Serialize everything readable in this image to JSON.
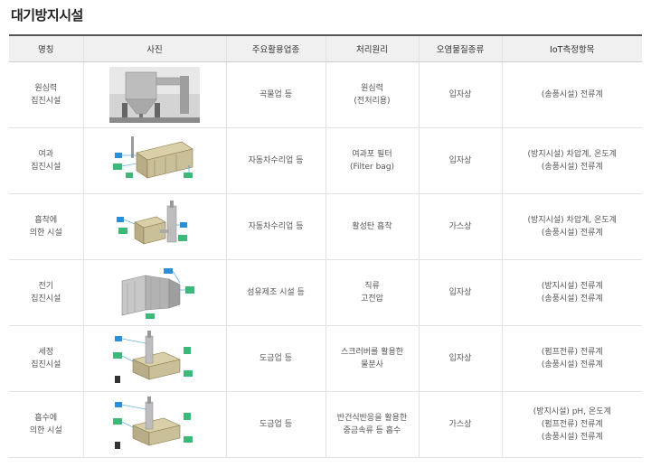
{
  "page_title": "대기방지시설",
  "table": {
    "headers": [
      "명칭",
      "사진",
      "주요활용업종",
      "처리원리",
      "오염물질종류",
      "IoT측정항목"
    ],
    "rows": [
      {
        "name": "원심력\n집진시설",
        "photo_icon": "cyclone-collector-photo",
        "industry": "곡물업 등",
        "principle": "원심력\n(전처리용)",
        "pollutant": "입자상",
        "iot": "(송풍시설) 전류계"
      },
      {
        "name": "여과\n집진시설",
        "photo_icon": "bag-filter-diagram",
        "industry": "자동차수리업 등",
        "principle": "여과포 필터\n(Filter bag)",
        "pollutant": "입자상",
        "iot": "(방지시설) 차압계, 온도계\n(송풍시설) 전류계"
      },
      {
        "name": "흡착에\n의한 시설",
        "photo_icon": "adsorption-tower-diagram",
        "industry": "자동차수리업 등",
        "principle": "활성탄 흡착",
        "pollutant": "가스상",
        "iot": "(방지시설) 차압계, 온도계\n(송풍시설) 전류계"
      },
      {
        "name": "전기\n집진시설",
        "photo_icon": "electrostatic-precipitator-diagram",
        "industry": "섬유제조 시설 등",
        "principle": "직류\n고전압",
        "pollutant": "입자상",
        "iot": "(방지시설) 전류계\n(송풍시설) 전류계"
      },
      {
        "name": "세정\n집진시설",
        "photo_icon": "wet-scrubber-diagram",
        "industry": "도금업 등",
        "principle": "스크러버를 활용한\n물분사",
        "pollutant": "입자상",
        "iot": "(펌프전류) 전류계\n(송풍시설) 전류계"
      },
      {
        "name": "흡수에\n의한 시설",
        "photo_icon": "absorption-tower-diagram",
        "industry": "도금업 등",
        "principle": "반건식반응을 활용한\n중금속류 등 흡수",
        "pollutant": "가스상",
        "iot": "(방지시설) pH, 온도계\n(펌프전류) 전류계\n(송풍시설) 전류계"
      }
    ]
  },
  "colors": {
    "header_bg": "#f0f0f0",
    "header_rule": "#555555",
    "sensor_green": "#3cb878",
    "sensor_blue": "#2a8fd6"
  }
}
